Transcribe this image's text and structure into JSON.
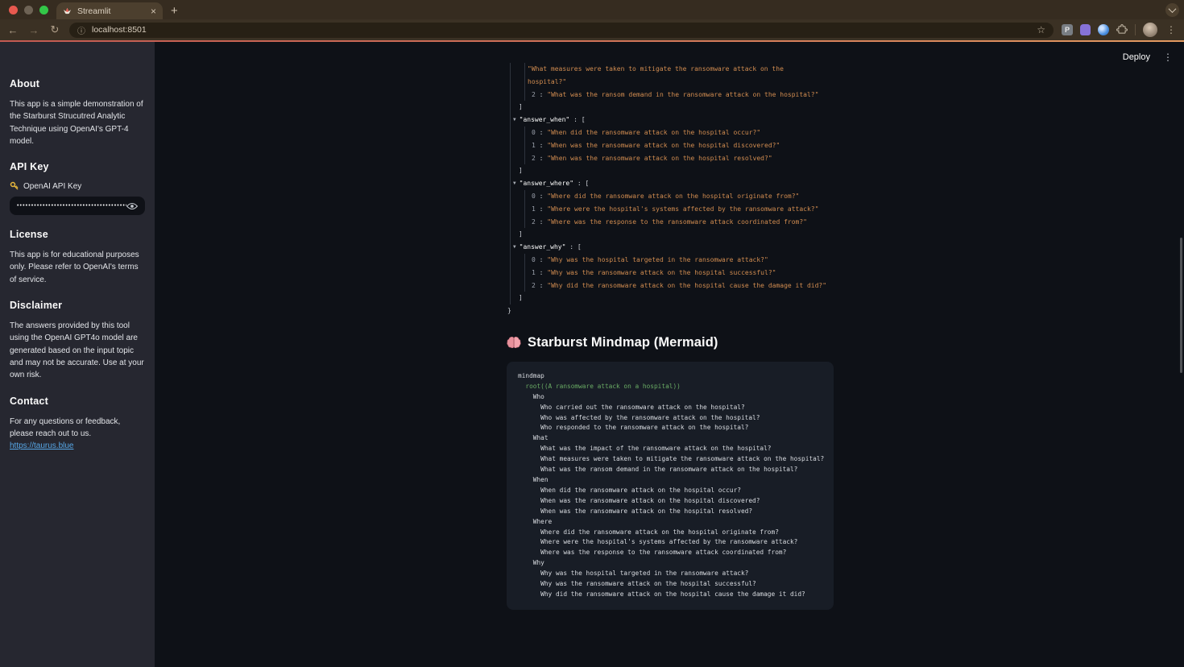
{
  "browser": {
    "tab": {
      "title": "Streamlit",
      "close_icon": "×",
      "new_tab_icon": "+"
    },
    "toolbar": {
      "back_icon": "←",
      "forward_icon": "→",
      "reload_icon": "↻",
      "info_icon": "ⓘ",
      "url": "localhost:8501",
      "star_icon": "☆",
      "extension_p_label": "P",
      "menu_icon": "⋮"
    }
  },
  "app_header": {
    "deploy_label": "Deploy",
    "menu_icon": "⋮"
  },
  "sidebar": {
    "about_heading": "About",
    "about_text": "This app is a simple demonstration of the Starburst Strucutred Analytic Technique using OpenAI's GPT-4 model.",
    "api_key_heading": "API Key",
    "api_key_label": "OpenAI API Key",
    "api_key_masked": "•••••••••••••••••••••••••••••••••••••••••••",
    "license_heading": "License",
    "license_text": "This app is for educational purposes only. Please refer to OpenAI's terms of service.",
    "disclaimer_heading": "Disclaimer",
    "disclaimer_text": "The answers provided by this tool using the OpenAI GPT4o model are generated based on the input topic and may not be accurate. Use at your own risk.",
    "contact_heading": "Contact",
    "contact_text": "For any questions or feedback, please reach out to us. ",
    "contact_link": "https://taurus.blue"
  },
  "json_viewer": {
    "colon": " : ",
    "arrow": "▼",
    "partial": {
      "line1": "\"What measures were taken to mitigate the ransomware attack on the",
      "line2": "hospital?\"",
      "item_index": "2",
      "item_value": "\"What was the ransom demand in the ransomware attack on the hospital?\"",
      "close": "]"
    },
    "groups": [
      {
        "key": "\"answer_when\"",
        "open": " : [",
        "close": "]",
        "items": [
          {
            "i": "0",
            "q": "\"When did the ransomware attack on the hospital occur?\""
          },
          {
            "i": "1",
            "q": "\"When was the ransomware attack on the hospital discovered?\""
          },
          {
            "i": "2",
            "q": "\"When was the ransomware attack on the hospital resolved?\""
          }
        ]
      },
      {
        "key": "\"answer_where\"",
        "open": " : [",
        "close": "]",
        "items": [
          {
            "i": "0",
            "q": "\"Where did the ransomware attack on the hospital originate from?\""
          },
          {
            "i": "1",
            "q": "\"Where were the hospital's systems affected by the ransomware attack?\""
          },
          {
            "i": "2",
            "q": "\"Where was the response to the ransomware attack coordinated from?\""
          }
        ]
      },
      {
        "key": "\"answer_why\"",
        "open": " : [",
        "close": "]",
        "items": [
          {
            "i": "0",
            "q": "\"Why was the hospital targeted in the ransomware attack?\""
          },
          {
            "i": "1",
            "q": "\"Why was the ransomware attack on the hospital successful?\""
          },
          {
            "i": "2",
            "q": "\"Why did the ransomware attack on the hospital cause the damage it did?\""
          }
        ]
      }
    ],
    "root_close": "}"
  },
  "mindmap": {
    "heading": "Starburst Mindmap (Mermaid)",
    "lines": [
      {
        "c": "plain",
        "t": "mindmap"
      },
      {
        "c": "green",
        "t": "  root((A ransomware attack on a hospital))"
      },
      {
        "c": "plain",
        "t": "    Who"
      },
      {
        "c": "plain",
        "t": "      Who carried out the ransomware attack on the hospital?"
      },
      {
        "c": "plain",
        "t": "      Who was affected by the ransomware attack on the hospital?"
      },
      {
        "c": "plain",
        "t": "      Who responded to the ransomware attack on the hospital?"
      },
      {
        "c": "plain",
        "t": "    What"
      },
      {
        "c": "plain",
        "t": "      What was the impact of the ransomware attack on the hospital?"
      },
      {
        "c": "plain",
        "t": "      What measures were taken to mitigate the ransomware attack on the hospital?"
      },
      {
        "c": "plain",
        "t": "      What was the ransom demand in the ransomware attack on the hospital?"
      },
      {
        "c": "plain",
        "t": "    When"
      },
      {
        "c": "plain",
        "t": "      When did the ransomware attack on the hospital occur?"
      },
      {
        "c": "plain",
        "t": "      When was the ransomware attack on the hospital discovered?"
      },
      {
        "c": "plain",
        "t": "      When was the ransomware attack on the hospital resolved?"
      },
      {
        "c": "plain",
        "t": "    Where"
      },
      {
        "c": "plain",
        "t": "      Where did the ransomware attack on the hospital originate from?"
      },
      {
        "c": "plain",
        "t": "      Where were the hospital's systems affected by the ransomware attack?"
      },
      {
        "c": "plain",
        "t": "      Where was the response to the ransomware attack coordinated from?"
      },
      {
        "c": "plain",
        "t": "    Why"
      },
      {
        "c": "plain",
        "t": "      Why was the hospital targeted in the ransomware attack?"
      },
      {
        "c": "plain",
        "t": "      Why was the ransomware attack on the hospital successful?"
      },
      {
        "c": "plain",
        "t": "      Why did the ransomware attack on the hospital cause the damage it did?"
      }
    ]
  },
  "colors": {
    "accent_gradient_left": "#c35a52",
    "accent_gradient_right": "#e29a60",
    "json_string": "#d18c50",
    "mermaid_green": "#69ab64",
    "sidebar_bg": "#262730",
    "main_bg": "#0e1117",
    "link_blue": "#57a8e8"
  }
}
